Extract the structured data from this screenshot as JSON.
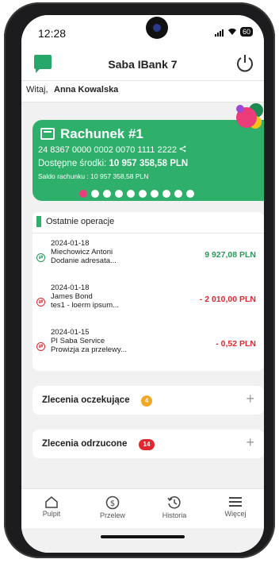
{
  "status_bar": {
    "time": "12:28",
    "battery": "60"
  },
  "header": {
    "title": "Saba IBank 7"
  },
  "greeting": {
    "prefix": "Witaj, ",
    "name": "Anna Kowalska"
  },
  "account_card": {
    "name": "Rachunek #1",
    "number": "24 8367 0000 0002 0070 1111 2222",
    "available_label": "Dostępne środki: ",
    "available_amount": "10 957 358,58 PLN",
    "saldo": "Saldo rachunku : 10 957 358,58 PLN",
    "pager_count": 10,
    "pager_active": 0,
    "colors": {
      "card": "#2fb06a",
      "active_dot": "#ec3c7a"
    }
  },
  "operations": {
    "title": "Ostatnie operacje",
    "items": [
      {
        "date": "2024-01-18",
        "party": "Miechowicz Antoni",
        "desc": "Dodanie adresata...",
        "amount": "9 927,08 PLN",
        "direction": "in",
        "color": "#2a9a5a"
      },
      {
        "date": "2024-01-18",
        "party": "James Bond",
        "desc": "tes1 - loerm ipsum...",
        "amount": "- 2 010,00 PLN",
        "direction": "out",
        "color": "#e0282e"
      },
      {
        "date": "2024-01-15",
        "party": "PI Saba Service",
        "desc": "Prowizja za przelewy...",
        "amount": "- 0,52 PLN",
        "direction": "out",
        "color": "#e0282e"
      }
    ]
  },
  "pending_orders": {
    "label": "Zlecenia oczekujące",
    "count": "4",
    "badge_color": "#f5a623"
  },
  "rejected_orders": {
    "label": "Zlecenia odrzucone",
    "count": "14",
    "badge_color": "#e0282e"
  },
  "tabbar": {
    "items": [
      {
        "label": "Pulpit",
        "icon": "home-icon"
      },
      {
        "label": "Przelew",
        "icon": "transfer-icon"
      },
      {
        "label": "Historia",
        "icon": "history-icon"
      },
      {
        "label": "Więcej",
        "icon": "menu-icon"
      }
    ]
  }
}
